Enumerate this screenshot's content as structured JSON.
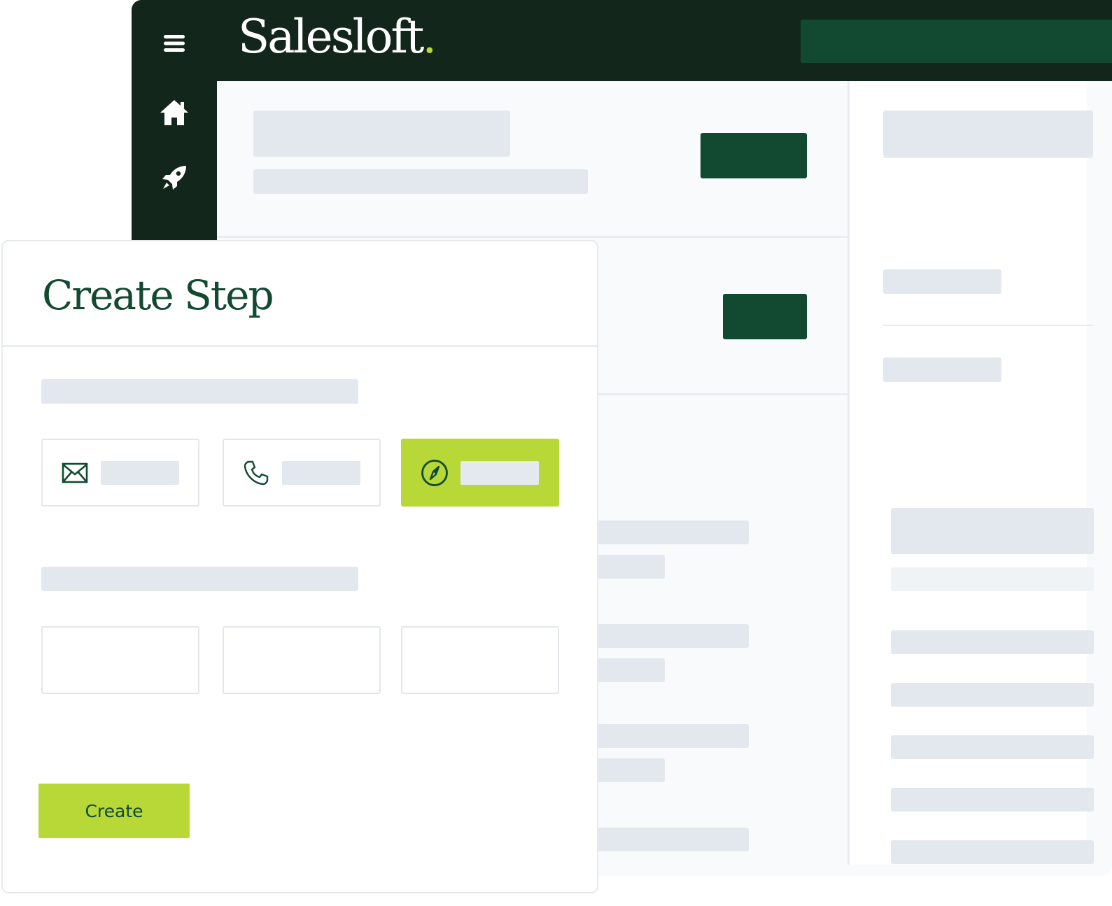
{
  "header": {
    "logo_text": "Salesloft",
    "logo_dot": "."
  },
  "sidebar": {
    "items": [
      {
        "icon": "menu-icon"
      },
      {
        "icon": "home-icon"
      },
      {
        "icon": "rocket-icon"
      }
    ]
  },
  "modal": {
    "title": "Create Step",
    "step_types": [
      {
        "icon": "email-icon",
        "selected": false
      },
      {
        "icon": "phone-icon",
        "selected": false
      },
      {
        "icon": "compass-icon",
        "selected": true
      }
    ],
    "create_label": "Create"
  },
  "colors": {
    "dark_green": "#12261c",
    "brand_green": "#124a31",
    "accent_lime": "#b7d836",
    "skeleton": "#e2e8ee",
    "background": "#f8fafc"
  }
}
